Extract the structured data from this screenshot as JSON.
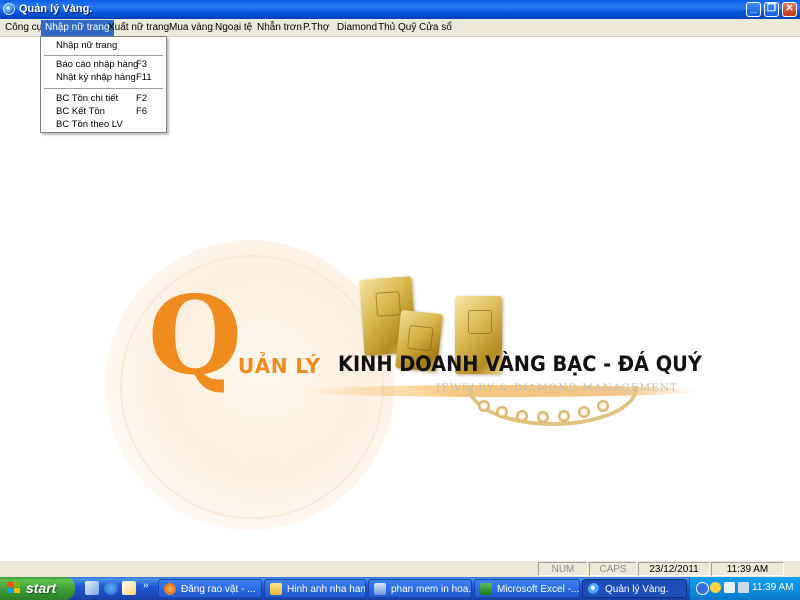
{
  "window": {
    "title": "Quản lý Vàng.",
    "controls": {
      "minimize": "_",
      "maximize": "❐",
      "close": "✕"
    }
  },
  "menu": {
    "items": [
      "Công cụ",
      "Nhập nữ trang",
      "Xuất nữ trang",
      "Mua vàng",
      "Ngoại tệ",
      "Nhẫn trơn",
      "P.Thợ",
      "Diamond",
      "Thủ Quỹ",
      "Cửa sổ"
    ],
    "active_index": 1
  },
  "dropdown": {
    "items": [
      {
        "label": "Nhập nữ trang",
        "shortcut": ""
      },
      {
        "label": "Báo cáo nhập hàng",
        "shortcut": "F3"
      },
      {
        "label": "Nhật ký nhập hàng",
        "shortcut": "F11"
      },
      {
        "label": "BC Tồn chi tiết",
        "shortcut": "F2"
      },
      {
        "label": "BC Kết Tồn",
        "shortcut": "F6"
      },
      {
        "label": "BC Tồn theo LV",
        "shortcut": ""
      }
    ]
  },
  "logo": {
    "letter": "Q",
    "rest": "UẢN LÝ",
    "title": "KINH DOANH VÀNG BẠC - ĐÁ QUÝ",
    "subtitle": "JEWELRY & DIAMOND MANAGEMENT",
    "accent_color": "#f08c1d"
  },
  "statusbar": {
    "num": "NUM",
    "caps": "CAPS",
    "date": "23/12/2011",
    "time": "11:39 AM"
  },
  "taskbar": {
    "start_label": "start",
    "quick_launch_more": "»",
    "tasks": [
      {
        "label": "Đăng rao vặt - ...",
        "icon": "firefox-icon",
        "active": false
      },
      {
        "label": "Hinh anh nha hang",
        "icon": "folder-icon",
        "active": false
      },
      {
        "label": "phan mem in hoa...",
        "icon": "window-icon",
        "active": false
      },
      {
        "label": "Microsoft Excel -...",
        "icon": "excel-icon",
        "active": false
      },
      {
        "label": "Quản lý Vàng.",
        "icon": "app-icon",
        "active": true
      }
    ],
    "clock": "11:39 AM"
  }
}
